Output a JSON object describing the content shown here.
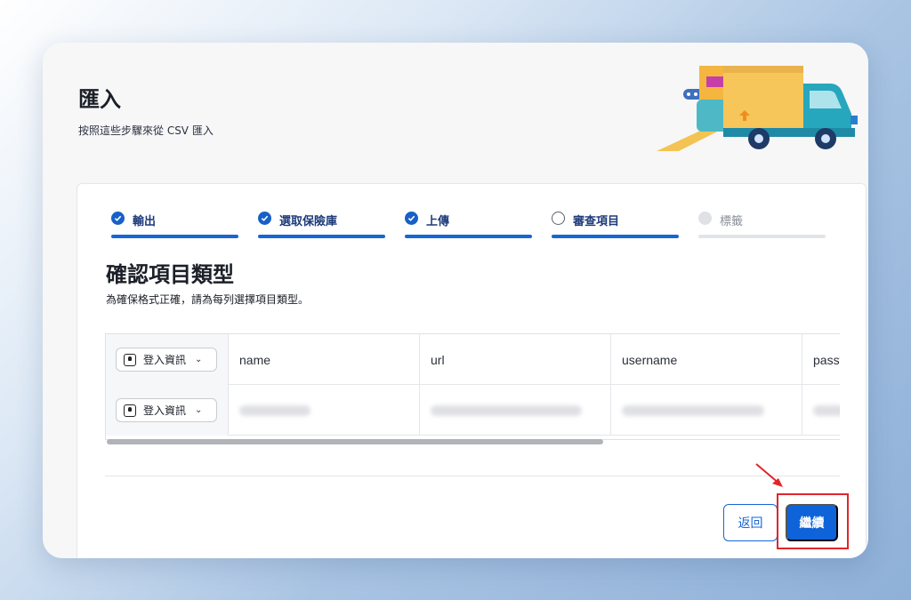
{
  "header": {
    "title": "匯入",
    "subtitle": "按照這些步驟來從 CSV 匯入"
  },
  "steps": [
    {
      "label": "輸出",
      "state": "done"
    },
    {
      "label": "選取保險庫",
      "state": "done"
    },
    {
      "label": "上傳",
      "state": "done"
    },
    {
      "label": "審查項目",
      "state": "current"
    },
    {
      "label": "標籤",
      "state": "pending"
    }
  ],
  "section": {
    "title": "確認項目類型",
    "description": "為確保格式正確，請為每列選擇項目類型。"
  },
  "table": {
    "rows": [
      {
        "type": "登入資訊",
        "cells": [
          "name",
          "url",
          "username",
          "passw"
        ]
      },
      {
        "type": "登入資訊",
        "cells": [
          "",
          "",
          "",
          ""
        ]
      }
    ]
  },
  "actions": {
    "back_label": "返回",
    "continue_label": "繼續"
  },
  "colors": {
    "accent": "#0f63d9",
    "annotation": "#e0262a"
  },
  "icons": [
    "checkmark-icon",
    "key-icon",
    "chevron-down-icon",
    "delivery-truck-illustration",
    "red-arrow-icon"
  ]
}
